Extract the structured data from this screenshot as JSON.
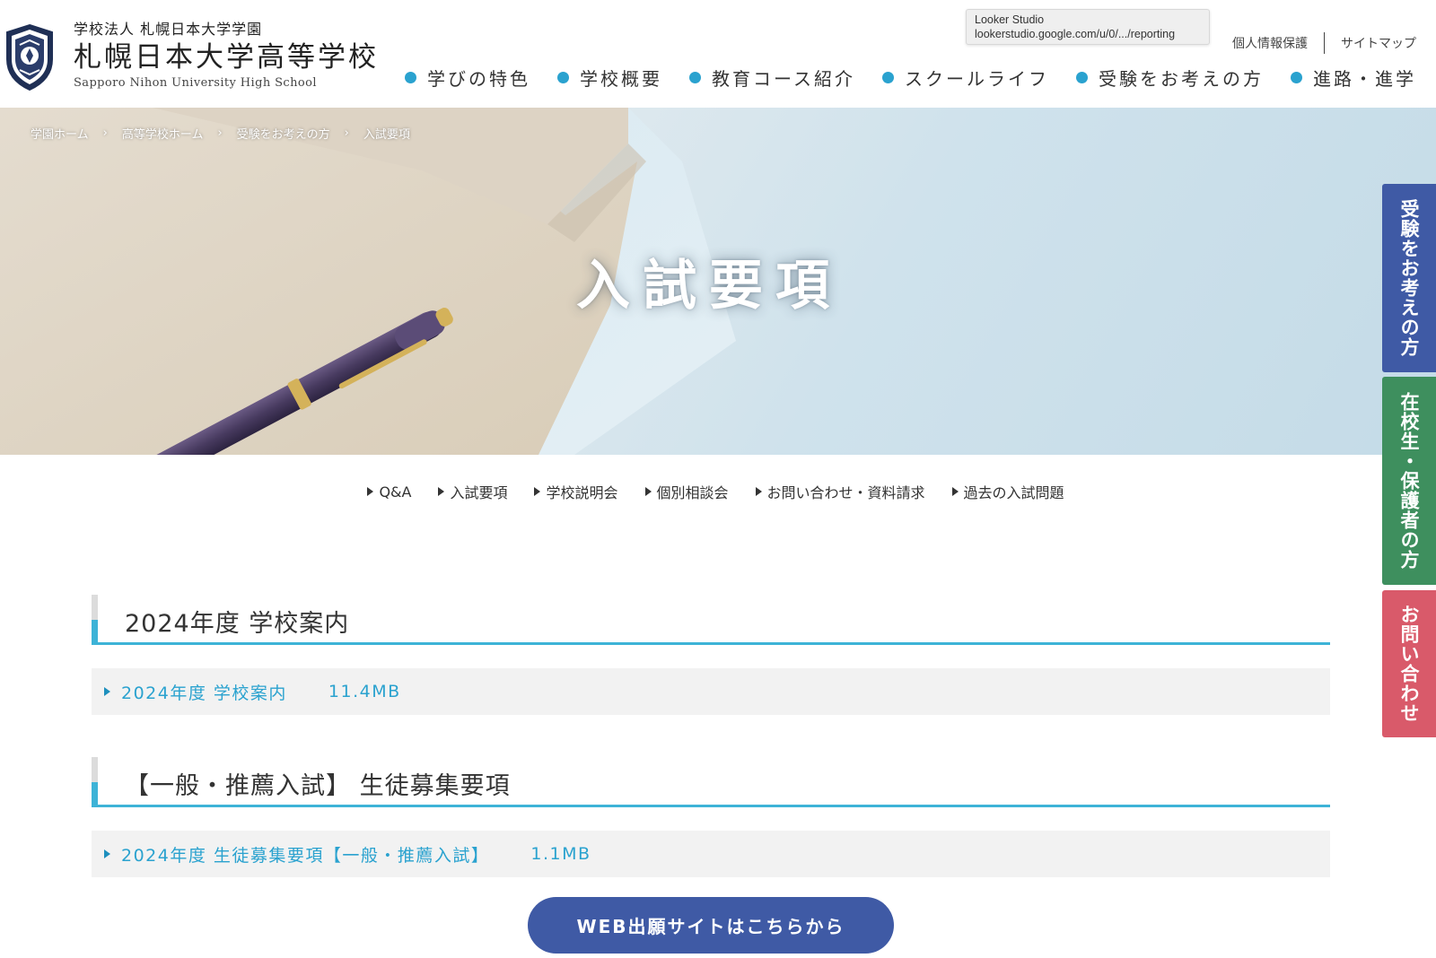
{
  "header": {
    "logo_corp": "学校法人 札幌日本大学学園",
    "logo_school": "札幌日本大学高等学校",
    "logo_en": "Sapporo Nihon University High School",
    "util_links": [
      "個人情報保護",
      "サイトマップ"
    ],
    "nav": [
      "学びの特色",
      "学校概要",
      "教育コース紹介",
      "スクールライフ",
      "受験をお考えの方",
      "進路・進学"
    ],
    "accent_color": "#2aa2cf"
  },
  "tooltip": {
    "title": "Looker Studio",
    "url": "lookerstudio.google.com/u/0/.../reporting"
  },
  "breadcrumb": [
    "学園ホーム",
    "高等学校ホーム",
    "受験をお考えの方",
    "入試要項"
  ],
  "breadcrumb_sep": "›",
  "hero": {
    "title": "入試要項"
  },
  "sub_nav": [
    "Q&A",
    "入試要項",
    "学校説明会",
    "個別相談会",
    "お問い合わせ・資料請求",
    "過去の入試問題"
  ],
  "sections": [
    {
      "heading": "2024年度 学校案内",
      "doc": {
        "name": "2024年度 学校案内",
        "size": "11.4MB"
      }
    },
    {
      "heading": "【一般・推薦入試】 生徒募集要項",
      "doc": {
        "name": "2024年度 生徒募集要項【一般・推薦入試】",
        "size": "1.1MB"
      }
    }
  ],
  "web_button": "WEB出願サイトはこちらから",
  "side_tabs": {
    "exam": "受験をお考えの方",
    "current": "在校生・保護者の方",
    "contact": "お問い合わせ",
    "colors": {
      "exam": "#3f5aa5",
      "current": "#3e8f5e",
      "contact": "#d95a6a"
    }
  }
}
